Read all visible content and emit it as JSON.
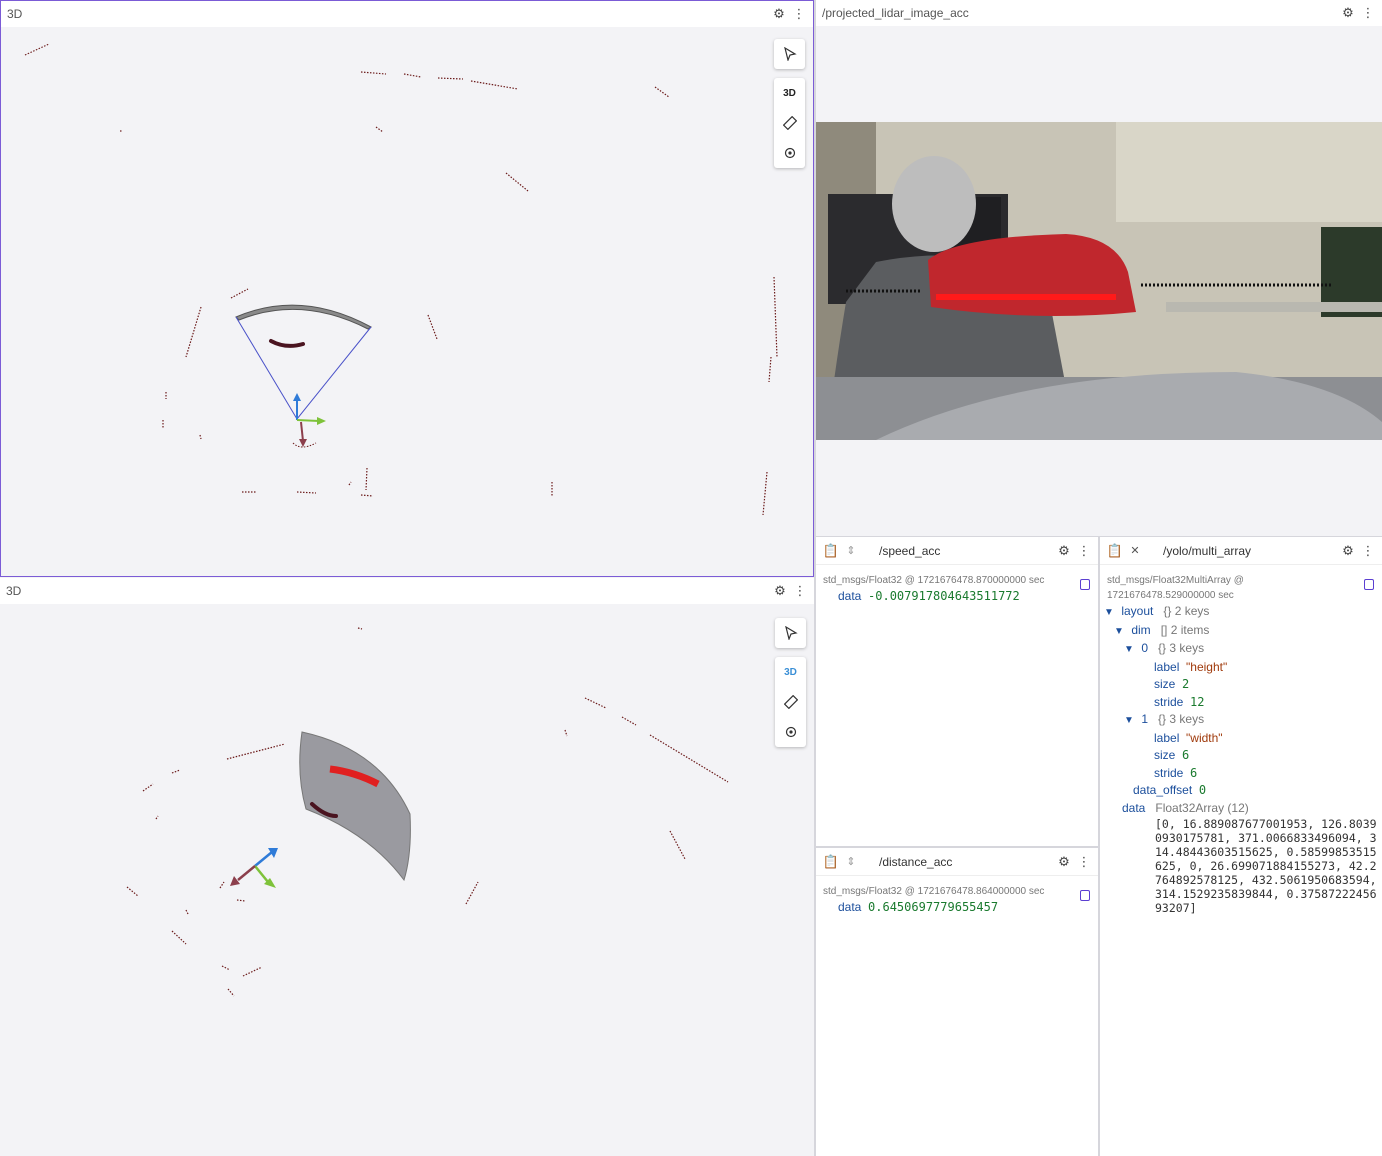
{
  "panel_3d_top": {
    "title": "3D",
    "toolbar": {
      "mode_label": "3D"
    }
  },
  "panel_3d_bottom": {
    "title": "3D",
    "toolbar": {
      "mode_label": "3D"
    }
  },
  "image_panel": {
    "title": "/projected_lidar_image_acc"
  },
  "speed_panel": {
    "topic": "/speed_acc",
    "meta": "std_msgs/Float32 @ 1721676478.870000000 sec",
    "key": "data",
    "value": "-0.007917804643511772"
  },
  "distance_panel": {
    "topic": "/distance_acc",
    "meta": "std_msgs/Float32 @ 1721676478.864000000 sec",
    "key": "data",
    "value": "0.6450697779655457"
  },
  "yolo_panel": {
    "topic": "/yolo/multi_array",
    "meta": "std_msgs/Float32MultiArray @ 1721676478.529000000 sec",
    "layout_key": "layout",
    "layout_meta": "{}  2 keys",
    "dim_key": "dim",
    "dim_meta": "[]  2 items",
    "item0_key": "0",
    "item0_meta": "{}  3 keys",
    "item0_label_key": "label",
    "item0_label_val": "\"height\"",
    "item0_size_key": "size",
    "item0_size_val": "2",
    "item0_stride_key": "stride",
    "item0_stride_val": "12",
    "item1_key": "1",
    "item1_meta": "{}  3 keys",
    "item1_label_key": "label",
    "item1_label_val": "\"width\"",
    "item1_size_key": "size",
    "item1_size_val": "6",
    "item1_stride_key": "stride",
    "item1_stride_val": "6",
    "offset_key": "data_offset",
    "offset_val": "0",
    "data_key": "data",
    "data_meta": "Float32Array (12)",
    "data_val": "[0, 16.889087677001953, 126.80390930175781, 371.0066833496094, 314.48443603515625, 0.58599853515625, 0, 26.699071884155273, 42.2764892578125, 432.5061950683594, 314.1529235839844, 0.3758722245693207]"
  },
  "icons": {
    "settings": "gear-icon",
    "menu": "kebab-menu-icon",
    "select": "select-pointer-icon",
    "measure": "ruler-icon",
    "publish": "target-icon",
    "clipboard": "clipboard-icon",
    "expand": "expand-icon",
    "copy": "copy-icon"
  },
  "colors": {
    "accent": "#7b5bd6",
    "key": "#1c4f9c",
    "number": "#1a7a2e",
    "string": "#a03a0c",
    "lidar_point": "#6b1a1a"
  }
}
